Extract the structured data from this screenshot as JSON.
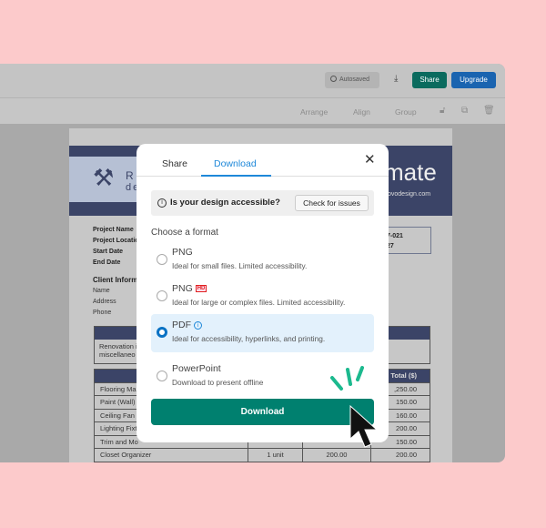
{
  "topbar": {
    "autosaved": "Autosaved",
    "share": "Share",
    "upgrade": "Upgrade",
    "icons": [
      "check-circle-icon",
      "download-icon"
    ]
  },
  "toolbar": {
    "arrange": "Arrange",
    "align": "Align",
    "group": "Group",
    "icons": [
      "lock-icon",
      "duplicate-icon",
      "trash-icon"
    ]
  },
  "document": {
    "logo_text_1": "REN",
    "logo_text_2": "desi",
    "title_fragment": "mate",
    "site_fragment": "ovodesign.com",
    "project_labels": [
      "Project Name",
      "Project Locatio",
      "Start Date",
      "End Date"
    ],
    "project_values": [
      "7-021",
      "27"
    ],
    "client_heading": "Client Inform",
    "client_labels": [
      "Name",
      "Address",
      "Phone"
    ],
    "desc_lines": [
      "Renovation i",
      "miscellaneo"
    ],
    "items_header_total": "Total ($)",
    "items": [
      [
        "Flooring Ma",
        "",
        "",
        ",250.00"
      ],
      [
        "Paint (Wall)",
        "",
        "",
        "150.00"
      ],
      [
        "Ceiling Fan",
        "",
        "",
        "160.00"
      ],
      [
        "Lighting Fixt",
        "",
        "",
        "200.00"
      ],
      [
        "Trim and Mo",
        "",
        "",
        "150.00"
      ],
      [
        "Closet Organizer",
        "1 unit",
        "200.00",
        "200.00"
      ]
    ]
  },
  "modal": {
    "tabs": [
      {
        "label": "Share",
        "active": false
      },
      {
        "label": "Download",
        "active": true
      }
    ],
    "accessibility": {
      "question": "Is your design accessible?",
      "button": "Check for issues"
    },
    "choose_label": "Choose a format",
    "formats": [
      {
        "label": "PNG",
        "desc": "Ideal for small files. Limited accessibility.",
        "selected": false
      },
      {
        "label": "PNG",
        "badge": "HD",
        "desc": "Ideal for large or complex files. Limited accessibility.",
        "selected": false
      },
      {
        "label": "PDF",
        "desc": "Ideal for accessibility, hyperlinks, and printing.",
        "selected": true
      },
      {
        "label": "PowerPoint",
        "desc": "Download to present offline",
        "selected": false
      }
    ],
    "download_button": "Download"
  },
  "colors": {
    "accent": "#00806f",
    "brand_blue": "#1a73c9",
    "tab_active": "#1e88d9",
    "background": "#fccacb"
  }
}
